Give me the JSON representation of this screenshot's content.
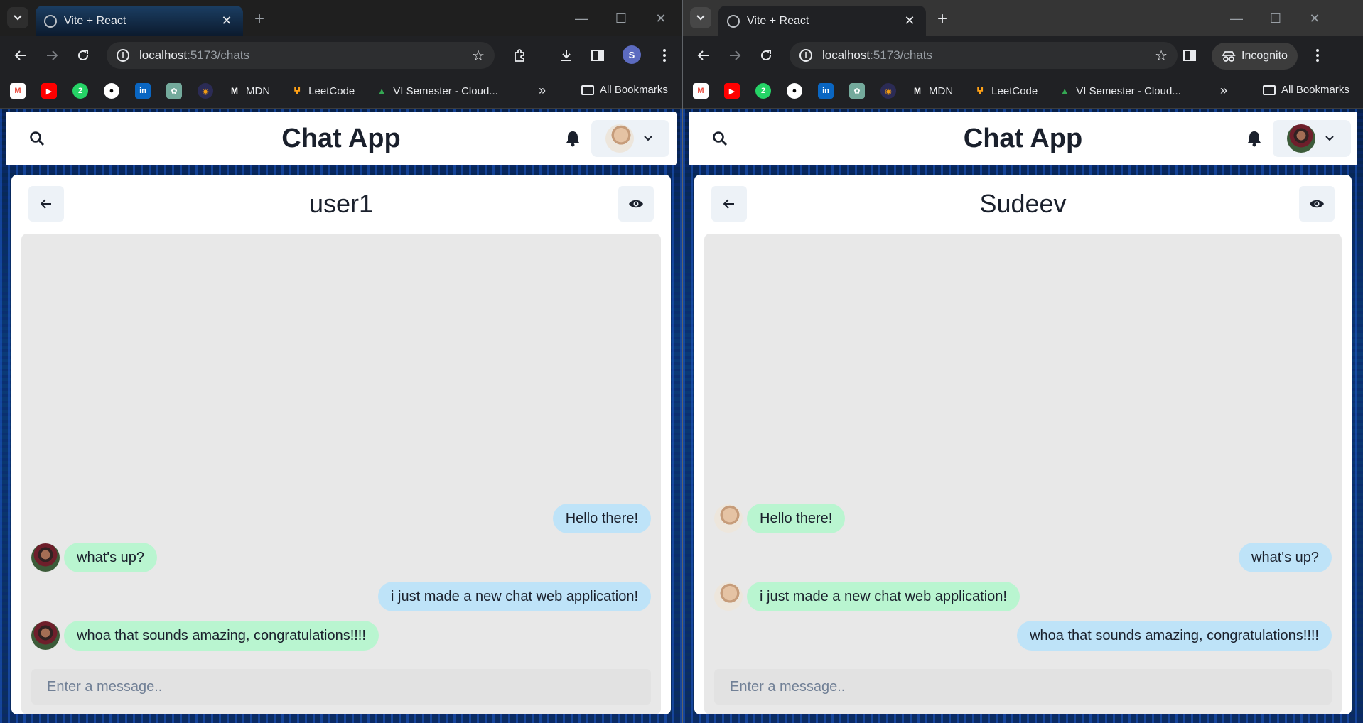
{
  "browser": {
    "tab_title": "Vite + React",
    "url_host": "localhost",
    "url_rest": ":5173/chats",
    "profile_initial": "S",
    "incognito_label": "Incognito",
    "bookmarks": [
      "MDN",
      "LeetCode",
      "VI Semester - Cloud..."
    ],
    "all_bookmarks": "All Bookmarks"
  },
  "app": {
    "title": "Chat App"
  },
  "left_window": {
    "chat_name": "user1",
    "input_placeholder": "Enter a message..",
    "messages": [
      {
        "text": "Hello there!",
        "dir": "out"
      },
      {
        "text": "what's up?",
        "dir": "in"
      },
      {
        "text": "i just made a new chat web application!",
        "dir": "out"
      },
      {
        "text": "whoa that sounds amazing, congratulations!!!!",
        "dir": "in"
      }
    ]
  },
  "right_window": {
    "chat_name": "Sudeev",
    "input_placeholder": "Enter a message..",
    "messages": [
      {
        "text": "Hello there!",
        "dir": "in"
      },
      {
        "text": "what's up?",
        "dir": "out"
      },
      {
        "text": "i just made a new chat web application!",
        "dir": "in"
      },
      {
        "text": "whoa that sounds amazing, congratulations!!!!",
        "dir": "out"
      }
    ]
  },
  "colors": {
    "bubble_out": "#bee3f8",
    "bubble_in": "#b9f5d0",
    "chat_bg": "#e8e8e8"
  }
}
